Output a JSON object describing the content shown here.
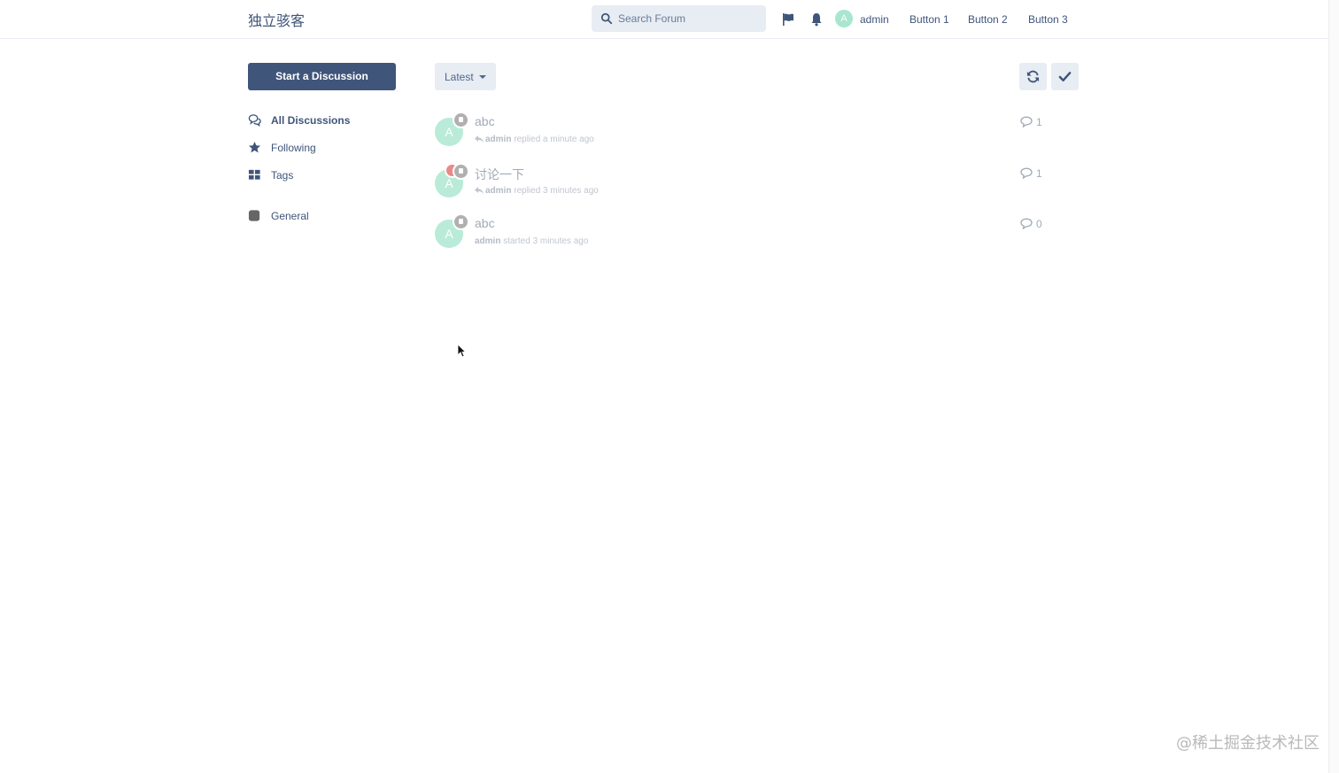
{
  "header": {
    "brand": "独立骇客",
    "search_placeholder": "Search Forum",
    "user_initial": "A",
    "username": "admin",
    "buttons": [
      "Button 1",
      "Button 2",
      "Button 3"
    ]
  },
  "sidebar": {
    "start_label": "Start a Discussion",
    "items": [
      {
        "label": "All Discussions",
        "icon": "comments-icon",
        "active": true
      },
      {
        "label": "Following",
        "icon": "star-icon"
      },
      {
        "label": "Tags",
        "icon": "grid-icon"
      },
      {
        "label": "General",
        "icon": "tag-square-icon"
      }
    ]
  },
  "toolbar": {
    "sort_label": "Latest",
    "refresh_icon": "refresh-icon",
    "mark_read_icon": "check-icon"
  },
  "discussions": [
    {
      "initial": "A",
      "title": "abc",
      "user": "admin",
      "action": "replied a minute ago",
      "replied": true,
      "count": "1"
    },
    {
      "initial": "A",
      "title": "讨论一下",
      "user": "admin",
      "action": "replied 3 minutes ago",
      "replied": true,
      "count": "1"
    },
    {
      "initial": "A",
      "title": "abc",
      "user": "admin",
      "action": "started 3 minutes ago",
      "replied": false,
      "count": "0"
    }
  ],
  "watermark": "@稀土掘金技术社区",
  "colors": {
    "primary": "#3f557a",
    "control_bg": "#e8ecf3",
    "avatar": "#a8e6cf"
  }
}
